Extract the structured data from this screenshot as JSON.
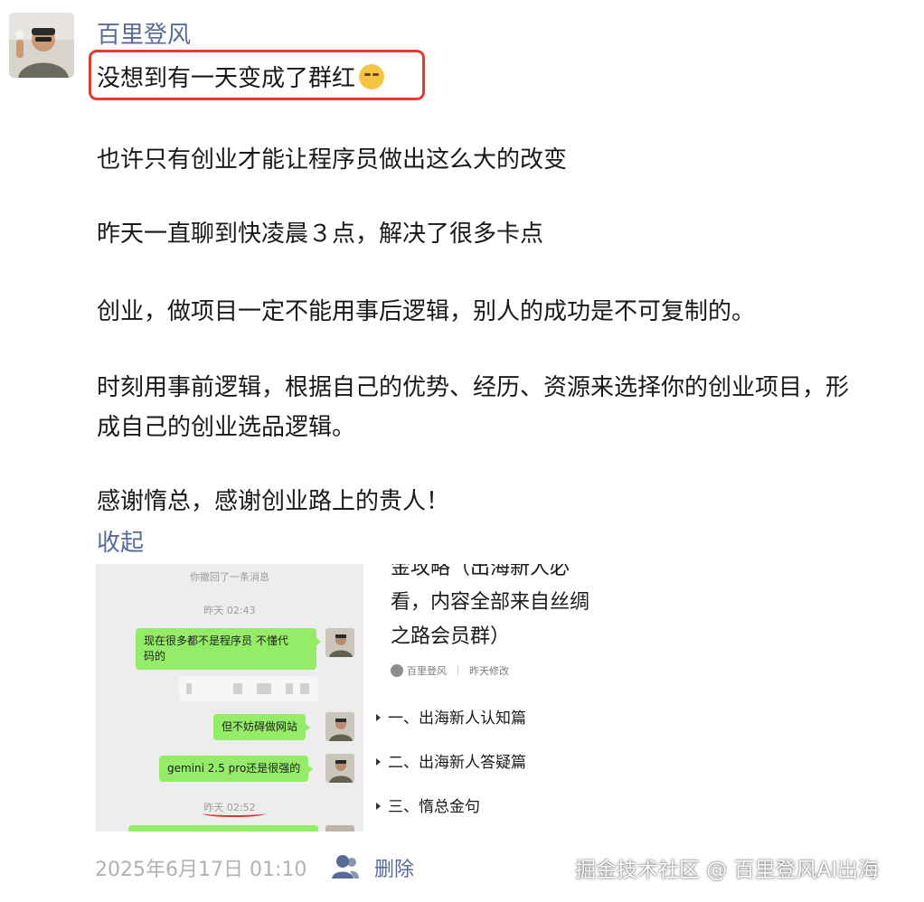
{
  "post": {
    "author": "百里登风",
    "first_line": "没想到有一天变成了群红",
    "emoji_icon": "face-with-tears-emoji",
    "paragraphs": [
      "也许只有创业才能让程序员做出这么大的改变",
      "昨天一直聊到快凌晨３点，解决了很多卡点",
      "创业，做项目一定不能用事后逻辑，别人的成功是不可复制的。",
      "时刻用事前逻辑，根据自己的优势、经历、资源来选择你的创业项目，形",
      "成自己的创业选品逻辑。",
      "感谢惰总，感谢创业路上的贵人！"
    ],
    "collapse_label": "收起",
    "highlight_color": "#e53a2f"
  },
  "chat_screenshot": {
    "recall_notice": "你撤回了一条消息",
    "time_1": "昨天 02:43",
    "msg_1_line1": "现在很多都不是程序员 不懂代",
    "msg_1_line2": "码的",
    "msg_2": "但不妨碍做网站",
    "msg_3": "gemini 2.5 pro还是很强的",
    "time_2": "昨天 02:52",
    "bubble_color": "#95ec69"
  },
  "doc_screenshot": {
    "title_line0": "金攻略（出海新人必",
    "title_line1": "看，内容全部来自丝绸",
    "title_line2": "之路会员群）",
    "meta_author": "百里登风",
    "meta_status": "昨天修改",
    "toc": [
      "一、出海新人认知篇",
      "二、出海新人答疑篇",
      "三、惰总金句"
    ]
  },
  "footer": {
    "date": "2025年6月17日 01:10",
    "delete_label": "删除",
    "watermark": "掘金技术社区 @ 百里登风AI出海"
  },
  "colors": {
    "link": "#576b95",
    "meta_gray": "#b2b2b2"
  }
}
